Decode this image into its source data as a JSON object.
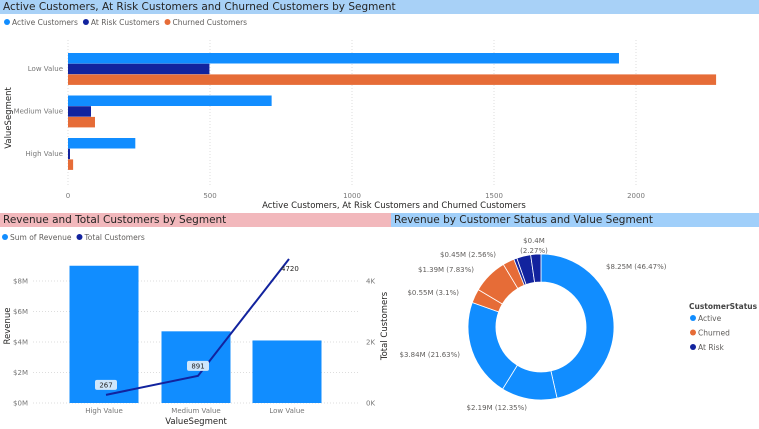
{
  "chart_data": [
    {
      "type": "bar",
      "orientation": "horizontal",
      "title": "Active Customers, At Risk Customers and Churned Customers by Segment",
      "categories": [
        "Low Value",
        "Medium Value",
        "High Value"
      ],
      "series": [
        {
          "name": "Active Customers",
          "color": "#118dff",
          "values": [
            1940,
            717,
            237
          ]
        },
        {
          "name": "At Risk Customers",
          "color": "#12239e",
          "values": [
            498,
            81,
            7
          ]
        },
        {
          "name": "Churned Customers",
          "color": "#e66c37",
          "values": [
            2282,
            95,
            18
          ]
        }
      ],
      "xlabel": "Active Customers, At Risk Customers and Churned Customers",
      "ylabel": "ValueSegment",
      "xlim": [
        0,
        2370
      ],
      "xticks": [
        "0",
        "500",
        "1000",
        "1500",
        "2000"
      ],
      "legend": "top-left",
      "grid": true
    },
    {
      "type": "bar+line",
      "title": "Revenue and Total Customers by Segment",
      "categories": [
        "High Value",
        "Medium Value",
        "Low Value"
      ],
      "series": [
        {
          "name": "Sum of Revenue",
          "color": "#118dff",
          "kind": "bar",
          "axis": "left",
          "values": [
            9.0,
            4.7,
            4.1
          ]
        },
        {
          "name": "Total Customers",
          "color": "#12239e",
          "kind": "line",
          "axis": "right",
          "values": [
            267,
            891,
            4720
          ],
          "labels": [
            "267",
            "891",
            "4720"
          ]
        }
      ],
      "xlabel": "ValueSegment",
      "ylabel": "Revenue",
      "y2label": "Total Customers",
      "ylim": [
        0,
        10
      ],
      "yticks": [
        "$0M",
        "$2M",
        "$4M",
        "$6M",
        "$8M"
      ],
      "y2lim": [
        0,
        5000
      ],
      "y2ticks": [
        "0K",
        "2K",
        "4K"
      ],
      "legend": "top-left",
      "grid": true
    },
    {
      "type": "pie",
      "donut": true,
      "title": "Revenue by Customer Status and Value Segment",
      "legend_title": "CustomerStatus",
      "legend": [
        {
          "label": "Active",
          "color": "#118dff"
        },
        {
          "label": "Churned",
          "color": "#e66c37"
        },
        {
          "label": "At Risk",
          "color": "#12239e"
        }
      ],
      "slices": [
        {
          "status": "Active",
          "value": 8.25,
          "percent": 46.47,
          "label": "$8.25M (46.47%)"
        },
        {
          "status": "Active",
          "value": 2.19,
          "percent": 12.35,
          "label": "$2.19M (12.35%)"
        },
        {
          "status": "Active",
          "value": 3.84,
          "percent": 21.63,
          "label": "$3.84M (21.63%)"
        },
        {
          "status": "Churned",
          "value": 0.55,
          "percent": 3.1,
          "label": "$0.55M (3.1%)"
        },
        {
          "status": "Churned",
          "value": 1.39,
          "percent": 7.83,
          "label": "$1.39M (7.83%)"
        },
        {
          "status": "Churned",
          "value": 0.45,
          "percent": 2.56,
          "label": "$0.45M (2.56%)"
        },
        {
          "status": "At Risk",
          "value": 0.12,
          "percent": 0.7,
          "label": ""
        },
        {
          "status": "At Risk",
          "value": 0.55,
          "percent": 3.09,
          "label": ""
        },
        {
          "status": "At Risk",
          "value": 0.4,
          "percent": 2.27,
          "label": "$0.4M",
          "label2": "(2.27%)"
        }
      ]
    }
  ],
  "headers": {
    "top": "Active Customers, At Risk Customers and Churned Customers by Segment",
    "bottom_left": "Revenue and Total Customers by Segment",
    "bottom_right": "Revenue by Customer Status and Value Segment"
  },
  "colors": {
    "top_header": "#a8d1f7",
    "left_header": "#f2b8bc",
    "right_header": "#a0cffa"
  }
}
